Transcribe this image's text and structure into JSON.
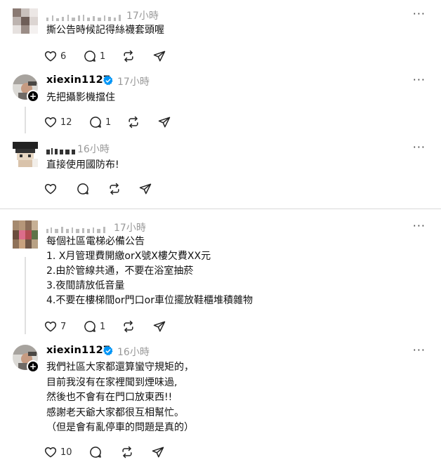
{
  "icons": {
    "like": "heart-icon",
    "reply": "comment-icon",
    "repost": "repost-icon",
    "share": "send-icon",
    "more": "more-icon",
    "verified": "verified-badge-icon"
  },
  "posts": [
    {
      "username": "",
      "time": "17小時",
      "lines": [
        "撕公告時候記得絲襪套頭喔"
      ],
      "likes": "6",
      "replies": "1"
    },
    {
      "username": "xiexin1127",
      "time": "17小時",
      "lines": [
        "先把攝影機擋住"
      ],
      "likes": "12",
      "replies": "1"
    },
    {
      "username": "",
      "time": "16小時",
      "lines": [
        "直接使用國防布!"
      ],
      "likes": "",
      "replies": ""
    },
    {
      "username": "",
      "time": "17小時",
      "lines": [
        "每個社區電梯必備公告",
        "1. X月管理費開繳orX號X樓欠費XX元",
        "2.由於管線共通，不要在浴室抽菸",
        "3.夜間請放低音量",
        "4.不要在樓梯間or門口or車位擺放鞋櫃堆積雜物"
      ],
      "likes": "7",
      "replies": "1"
    },
    {
      "username": "xiexin1127",
      "time": "16小時",
      "lines": [
        "我們社區大家都還算蠻守規矩的，",
        "目前我沒有在家裡聞到煙味過,",
        "然後也不會有在門口放東西!!",
        "感謝老天爺大家都很互相幫忙。",
        "（但是會有亂停車的問題是真的）"
      ],
      "likes": "10",
      "replies": ""
    }
  ],
  "more_label": "···"
}
